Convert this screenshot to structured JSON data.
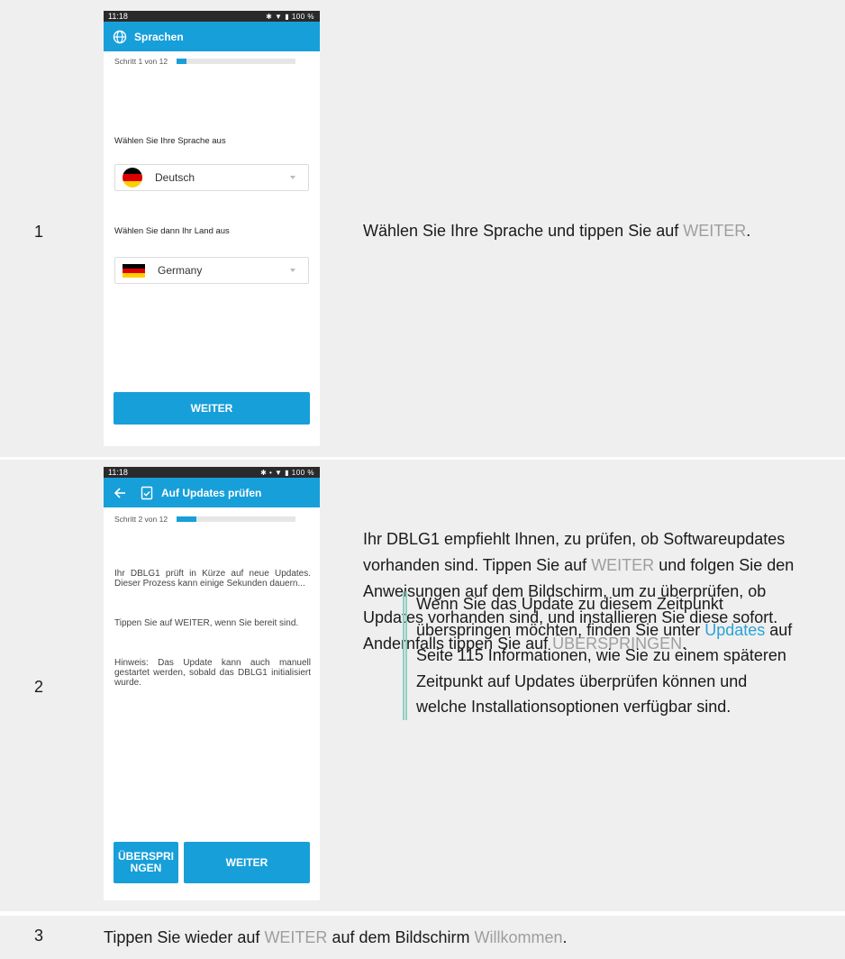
{
  "rows": [
    {
      "number": "1",
      "phone": {
        "status_time": "11:18",
        "status_icons": "✱ ▼ ▮ 100 %",
        "title": "Sprachen",
        "title_icon": "globe-icon",
        "step_text": "Schritt 1 von 12",
        "progress": 0.083,
        "language_label": "Wählen Sie Ihre Sprache aus",
        "language_value": "Deutsch",
        "country_label": "Wählen Sie dann Ihr Land aus",
        "country_value": "Germany",
        "next_button": "WEITER"
      },
      "description": {
        "before": "Wählen Sie Ihre Sprache und tippen Sie auf ",
        "link": "WEITER",
        "after": "."
      }
    },
    {
      "number": "2",
      "phone": {
        "status_time": "11:18",
        "status_icons": "✱ • ▼ ▮ 100 %",
        "title": "Auf Updates prüfen",
        "title_icon": "checklist-icon",
        "back_icon": "back-arrow-icon",
        "step_text": "Schritt 2 von 12",
        "progress": 0.167,
        "paragraph1": "Ihr DBLG1 prüft in Kürze auf neue Updates. Dieser Prozess kann einige Sekunden dauern...",
        "paragraph2": "Tippen Sie auf WEITER, wenn Sie bereit sind.",
        "paragraph3": "Hinweis: Das Update kann auch manuell gestartet werden, sobald das DBLG1 initialisiert wurde.",
        "skip_button_line1": "ÜBERSPRI",
        "skip_button_line2": "NGEN",
        "next_button": "WEITER"
      },
      "description": {
        "part1": "Ihr DBLG1 empfiehlt Ihnen, zu prüfen, ob Softwareupdates vorhanden sind. Tippen Sie auf ",
        "link1": "WEITER",
        "part2": " und folgen Sie den Anweisungen auf dem Bildschirm, um zu überprüfen, ob Updates vorhanden sind, und installieren Sie diese sofort. Andernfalls tippen Sie auf ",
        "link2": "ÜBERSPRINGEN",
        "part3": "."
      },
      "note": {
        "before": "Wenn Sie das Update zu diesem Zeitpunkt überspringen möchten, finden Sie unter ",
        "link": "Updates",
        "after": " auf Seite 115 Informationen, wie Sie zu einem späteren Zeitpunkt auf Updates überprüfen können und welche Installationsoptionen verfügbar sind."
      }
    },
    {
      "number": "3",
      "description": {
        "part1": "Tippen Sie wieder auf ",
        "link1": "WEITER",
        "part2": " auf dem Bildschirm ",
        "link2": "Willkommen",
        "part3": "."
      }
    }
  ],
  "colors": {
    "accent": "#179fd9",
    "link_grey": "#9e9e9e",
    "link_blue": "#2aa3d8",
    "note_bar": "#8fd0c1",
    "row_bg": "#efefef"
  }
}
